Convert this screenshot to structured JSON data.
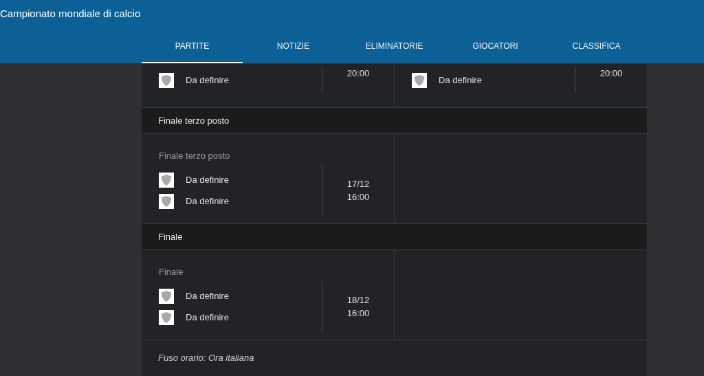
{
  "header": {
    "title": "Campionato mondiale di calcio"
  },
  "tabs": [
    {
      "label": "PARTITE",
      "selected": true
    },
    {
      "label": "NOTIZIE",
      "selected": false
    },
    {
      "label": "ELIMINATORIE",
      "selected": false
    },
    {
      "label": "GIOCATORI",
      "selected": false
    },
    {
      "label": "CLASSIFICA",
      "selected": false
    }
  ],
  "rows": [
    {
      "matches": [
        {
          "teams": [
            "Da definire"
          ],
          "when": [
            "20:00"
          ]
        },
        {
          "teams": [
            "Da definire"
          ],
          "when": [
            "20:00"
          ]
        }
      ]
    },
    {
      "title": "Finale terzo posto",
      "matches": [
        {
          "name": "Finale terzo posto",
          "teams": [
            "Da definire",
            "Da definire"
          ],
          "when": [
            "17/12",
            "16:00"
          ]
        }
      ]
    },
    {
      "title": "Finale",
      "matches": [
        {
          "name": "Finale",
          "teams": [
            "Da definire",
            "Da definire"
          ],
          "when": [
            "18/12",
            "16:00"
          ]
        }
      ]
    }
  ],
  "footer": {
    "timezone": "Fuso orario: Ora italiana"
  }
}
